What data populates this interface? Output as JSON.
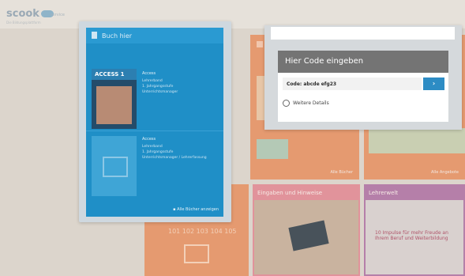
{
  "header": {
    "logo_text": "scook",
    "logo_sub": "service",
    "logo_tagline": "Die Bildungsplattform"
  },
  "book_card": {
    "title": "Buch hier",
    "book1": {
      "cover_title": "ACCESS 1",
      "heading": "Access",
      "lines": [
        "Lehrerband",
        "1. Jahrgangsstufe",
        "Unterrichtsmanager"
      ]
    },
    "book2": {
      "heading": "Access",
      "lines": [
        "Lehrerband",
        "1. Jahrgangsstufe",
        "Unterrichtsmanager / Lehrerfassung"
      ]
    },
    "all_books_label": "Alle Bücher anzeigen"
  },
  "code_dialog": {
    "title": "Hier Code eingeben",
    "code_value": "Code: abcde efg23",
    "submit_label": "›",
    "details_label": "Weitere Details"
  },
  "tiles": {
    "orange_mid_footer": "Alle Bücher",
    "orange_right_footer": "Alle Angebote",
    "pink_mid_header": "Eingaben und Hinweise",
    "purple_right_header": "Lehrerwelt",
    "purple_right_caption": "10 Impulse für mehr Freude an Ihrem Beruf und Weiterbildung",
    "orange_bottom_numbers": "101 102 103 104 105"
  },
  "colors": {
    "accent_blue": "#1f8fc7",
    "orange_tile": "#e59a70",
    "pink_tile": "#e1939b",
    "purple_tile": "#b57fa9"
  }
}
